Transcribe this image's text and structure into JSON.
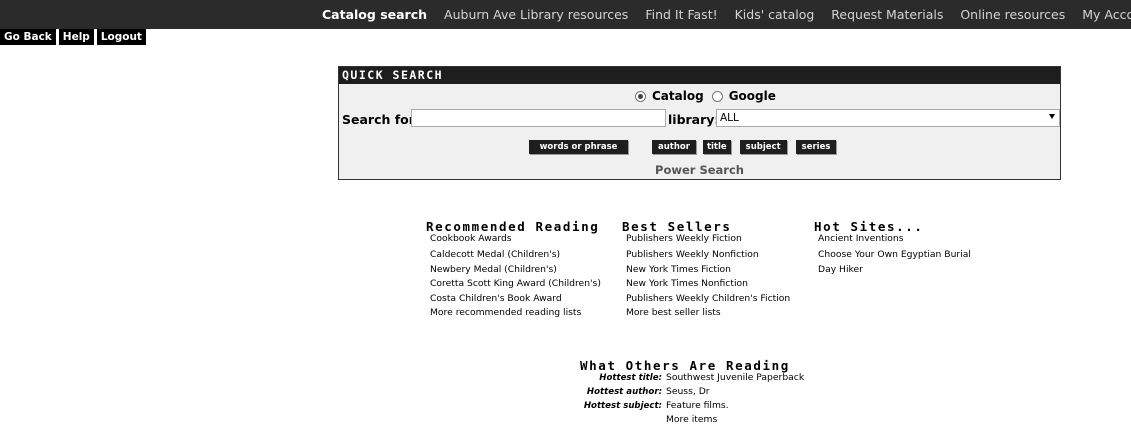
{
  "nav": {
    "links": [
      {
        "label": "Catalog search",
        "active": true
      },
      {
        "label": "Auburn Ave Library resources"
      },
      {
        "label": "Find It Fast!"
      },
      {
        "label": "Kids' catalog"
      },
      {
        "label": "Request Materials"
      },
      {
        "label": "Online resources"
      },
      {
        "label": "My Account"
      }
    ],
    "util": [
      "Go Back",
      "Help",
      "Logout"
    ]
  },
  "quick_search": {
    "title": "QUICK SEARCH",
    "radio_catalog": "Catalog",
    "radio_google": "Google",
    "search_label": "Search for",
    "search_value": "",
    "library_label": "library:",
    "library_value": "ALL",
    "buttons": [
      "words or phrase",
      "author",
      "title",
      "subject",
      "series"
    ],
    "power_search": "Power Search"
  },
  "recommended": {
    "title": "Recommended Reading",
    "items": [
      "Cookbook Awards",
      "Caldecott Medal (Children's)",
      "Newbery Medal (Children's)",
      "Coretta Scott King Award (Children's)",
      "Costa Children's Book Award",
      "More recommended reading lists"
    ]
  },
  "bestsellers": {
    "title": "Best Sellers",
    "items": [
      "Publishers Weekly Fiction",
      "Publishers Weekly Nonfiction",
      "New York Times Fiction",
      "New York Times Nonfiction",
      "Publishers Weekly Children's Fiction",
      "More best seller lists"
    ]
  },
  "hotsites": {
    "title": "Hot Sites...",
    "items": [
      "Ancient Inventions",
      "Choose Your Own Egyptian Burial",
      "Day Hiker"
    ]
  },
  "others": {
    "title": "What Others Are Reading",
    "rows": [
      {
        "label": "Hottest title:",
        "value": "Southwest Juvenile Paperback"
      },
      {
        "label": "Hottest author:",
        "value": "Seuss, Dr"
      },
      {
        "label": "Hottest subject:",
        "value": "Feature films."
      },
      {
        "label": "",
        "value": "More items"
      }
    ]
  }
}
